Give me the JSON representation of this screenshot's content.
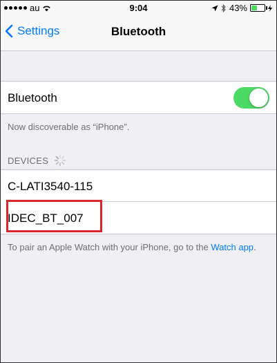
{
  "status_bar": {
    "carrier": "au",
    "time": "9:04",
    "battery": "43%",
    "battery_level": 0.43,
    "battery_color": "#4cd964"
  },
  "nav": {
    "back_label": "Settings",
    "title": "Bluetooth"
  },
  "bluetooth_cell": {
    "label": "Bluetooth",
    "enabled": true
  },
  "discoverable_text": "Now discoverable as “iPhone”.",
  "devices_header": "DEVICES",
  "devices": [
    {
      "name": "C-LATI3540-115"
    },
    {
      "name": "IDEC_BT_007"
    }
  ],
  "pair_text": {
    "prefix": "To pair an Apple Watch with your iPhone, go to the",
    "link": "Watch app",
    "suffix": "."
  },
  "colors": {
    "accent": "#007aff",
    "toggle_on": "#4cd964",
    "highlight": "#d9262c"
  }
}
